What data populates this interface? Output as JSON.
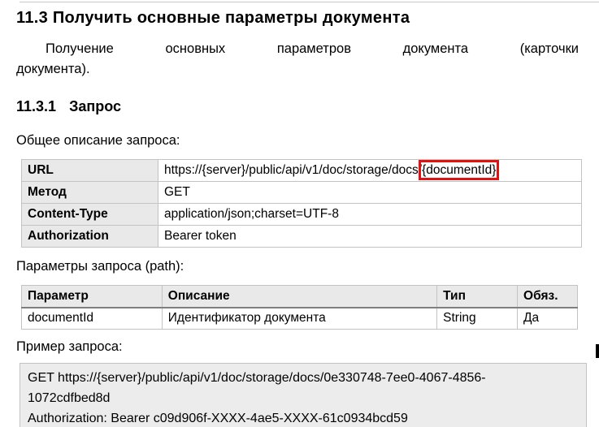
{
  "page": {
    "heading": "11.3 Получить основные параметры документа",
    "intro_line1": "Получение основных параметров документа (карточки",
    "intro_line2": "документа).",
    "subheading_num": "11.3.1",
    "subheading_title": "Запрос",
    "overview_label": "Общее описание запроса:",
    "path_params_label": "Параметры запроса (path):",
    "example_label": "Пример запроса:"
  },
  "request_table": {
    "rows": [
      {
        "name": "URL",
        "value_prefix": "https://{server}/public/api/v1/doc/storage/docs/",
        "value_highlight": "{documentId}"
      },
      {
        "name": "Метод",
        "value": "GET"
      },
      {
        "name": "Content-Type",
        "value": "application/json;charset=UTF-8"
      },
      {
        "name": "Authorization",
        "value": "Bearer token"
      }
    ]
  },
  "params_table": {
    "headers": [
      "Параметр",
      "Описание",
      "Тип",
      "Обяз."
    ],
    "rows": [
      [
        "documentId",
        "Идентификатор документа",
        "String",
        "Да"
      ]
    ]
  },
  "example_code": {
    "lines": [
      "GET https://{server}/public/api/v1/doc/storage/docs/0e330748-7ee0-4067-4856-",
      "1072cdfbed8d",
      "Authorization: Bearer c09d906f-XXXX-4ae5-XXXX-61c0934bcd59"
    ]
  },
  "colors": {
    "highlight_box": "#e01212",
    "table_border": "#c3c3c3",
    "shaded_cell": "#e9e9e9",
    "code_background": "#ececec"
  }
}
